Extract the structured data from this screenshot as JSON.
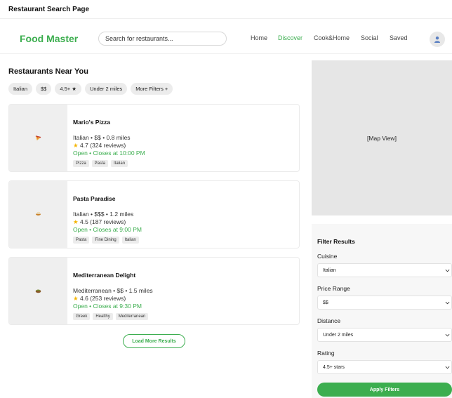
{
  "page": {
    "heading": "Restaurant Search Page"
  },
  "header": {
    "logo": "Food Master",
    "search_placeholder": "Search for restaurants...",
    "nav": [
      "Home",
      "Discover",
      "Cook&Home",
      "Social",
      "Saved"
    ],
    "active_nav": "Discover",
    "avatar_icon": "user-icon"
  },
  "results": {
    "title": "Restaurants Near You",
    "chips": [
      "Italian",
      "$$",
      "4.5+ ★",
      "Under 2 miles",
      "More Filters +"
    ],
    "restaurants": [
      {
        "name": "Mario's Pizza",
        "meta": "Italian • $$ • 0.8 miles",
        "rating": "4.7 (324 reviews)",
        "status": "Open • Closes at 10:00 PM",
        "tags": [
          "Pizza",
          "Pasta",
          "Italian"
        ],
        "icon": "pizza-icon"
      },
      {
        "name": "Pasta Paradise",
        "meta": "Italian • $$$ • 1.2 miles",
        "rating": "4.5 (187 reviews)",
        "status": "Open • Closes at 9:00 PM",
        "tags": [
          "Pasta",
          "Fine Dining",
          "Italian"
        ],
        "icon": "pasta-bowl-icon"
      },
      {
        "name": "Mediterranean Delight",
        "meta": "Mediterranean • $$ • 1.5 miles",
        "rating": "4.6 (253 reviews)",
        "status": "Open • Closes at 9:30 PM",
        "tags": [
          "Greek",
          "Healthy",
          "Mediterranean"
        ],
        "icon": "falafel-icon"
      }
    ],
    "load_more": "Load More Results"
  },
  "map": {
    "label": "[Map View]"
  },
  "filters": {
    "title": "Filter Results",
    "cuisine_label": "Cuisine",
    "cuisine_value": "Italian",
    "price_label": "Price Range",
    "price_value": "$$",
    "distance_label": "Distance",
    "distance_value": "Under 2 miles",
    "rating_label": "Rating",
    "rating_value": "4.5+ stars",
    "apply": "Apply Filters"
  },
  "colors": {
    "brand_green": "#3cae4f",
    "star": "#f4b400"
  }
}
